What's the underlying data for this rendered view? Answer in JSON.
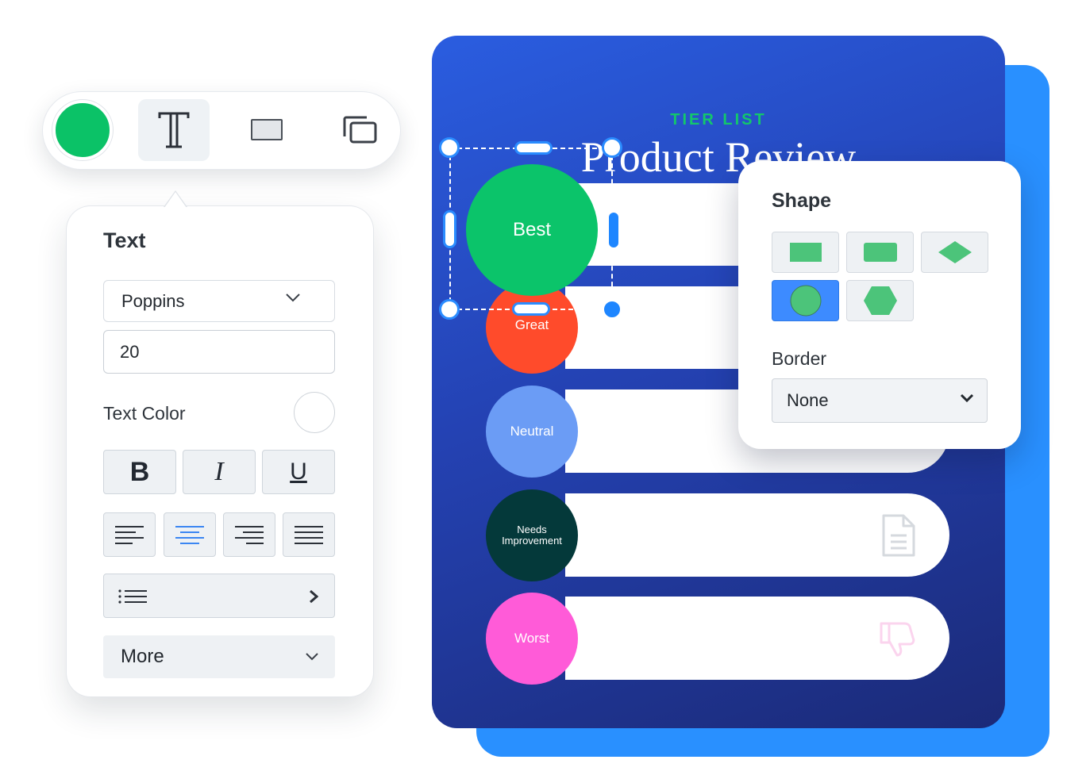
{
  "colors": {
    "accent_green": "#0bc267",
    "selection_blue": "#2a8cff",
    "card_blue": "#2442b3",
    "card_shadow_blue": "#2990ff"
  },
  "toolbar": {
    "fill_color": "#0bc267",
    "tools": [
      {
        "name": "text-tool",
        "icon": "text-icon",
        "active": true
      },
      {
        "name": "shape-tool",
        "icon": "rectangle-icon",
        "active": false
      },
      {
        "name": "layers-tool",
        "icon": "layers-icon",
        "active": false
      }
    ]
  },
  "text_panel": {
    "title": "Text",
    "font_family": "Poppins",
    "font_size": "20",
    "text_color_label": "Text Color",
    "text_color": "#ffffff",
    "format": {
      "bold": "B",
      "italic": "I",
      "underline": "U"
    },
    "alignments": [
      {
        "name": "align-left",
        "active": false
      },
      {
        "name": "align-center",
        "active": true
      },
      {
        "name": "align-right",
        "active": false
      },
      {
        "name": "align-justify",
        "active": false
      }
    ],
    "list_icon": "bulleted-list-icon",
    "more_label": "More"
  },
  "card": {
    "eyebrow": "TIER LIST",
    "title": "Product Review",
    "tiers": [
      {
        "label": "Best",
        "color": "#0bc46a",
        "selected": true
      },
      {
        "label": "Great",
        "color": "#ff4b2b"
      },
      {
        "label": "Neutral",
        "color": "#6b9cf5"
      },
      {
        "label": "Needs Improvement",
        "color": "#04393a",
        "icon": "document-icon"
      },
      {
        "label": "Worst",
        "color": "#ff5bd8",
        "icon": "thumbs-down-icon"
      }
    ]
  },
  "shape_panel": {
    "title": "Shape",
    "shapes": [
      {
        "name": "rectangle",
        "active": false
      },
      {
        "name": "rounded-rectangle",
        "active": false
      },
      {
        "name": "diamond",
        "active": false
      },
      {
        "name": "circle",
        "active": true
      },
      {
        "name": "hexagon",
        "active": false
      }
    ],
    "shape_color": "#4cc47a",
    "border_label": "Border",
    "border_value": "None"
  }
}
